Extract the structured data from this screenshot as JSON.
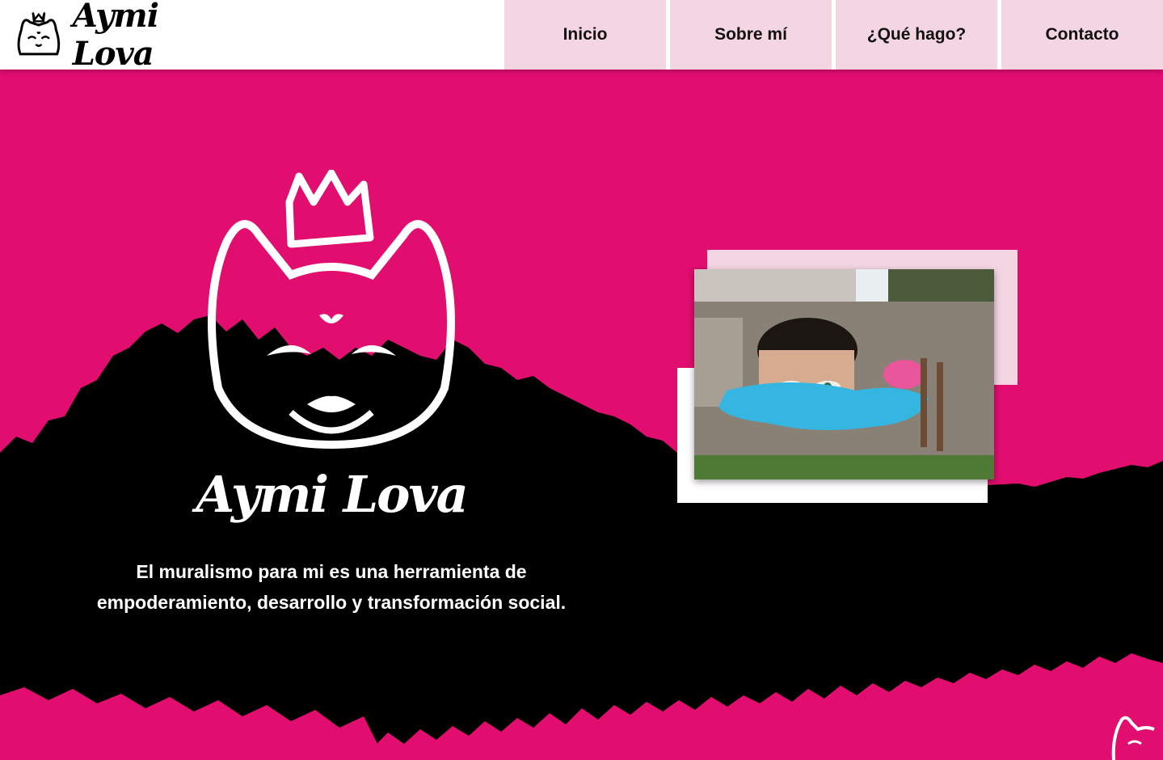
{
  "header": {
    "brand_name": "Aymi Lova",
    "nav": [
      {
        "label": "Inicio"
      },
      {
        "label": "Sobre mí"
      },
      {
        "label": "¿Qué hago?"
      },
      {
        "label": "Contacto"
      }
    ]
  },
  "hero": {
    "title": "Aymi Lova",
    "tagline_line1": "El muralismo para mi es una herramienta de",
    "tagline_line2": "empoderamiento, desarrollo y transformación social."
  },
  "colors": {
    "brand_pink": "#e10d6f",
    "nav_pink": "#f4d5e2",
    "ink": "#000000",
    "white": "#ffffff"
  },
  "icons": {
    "logo": "crowned-fox-icon",
    "corner": "fox-outline-icon"
  }
}
